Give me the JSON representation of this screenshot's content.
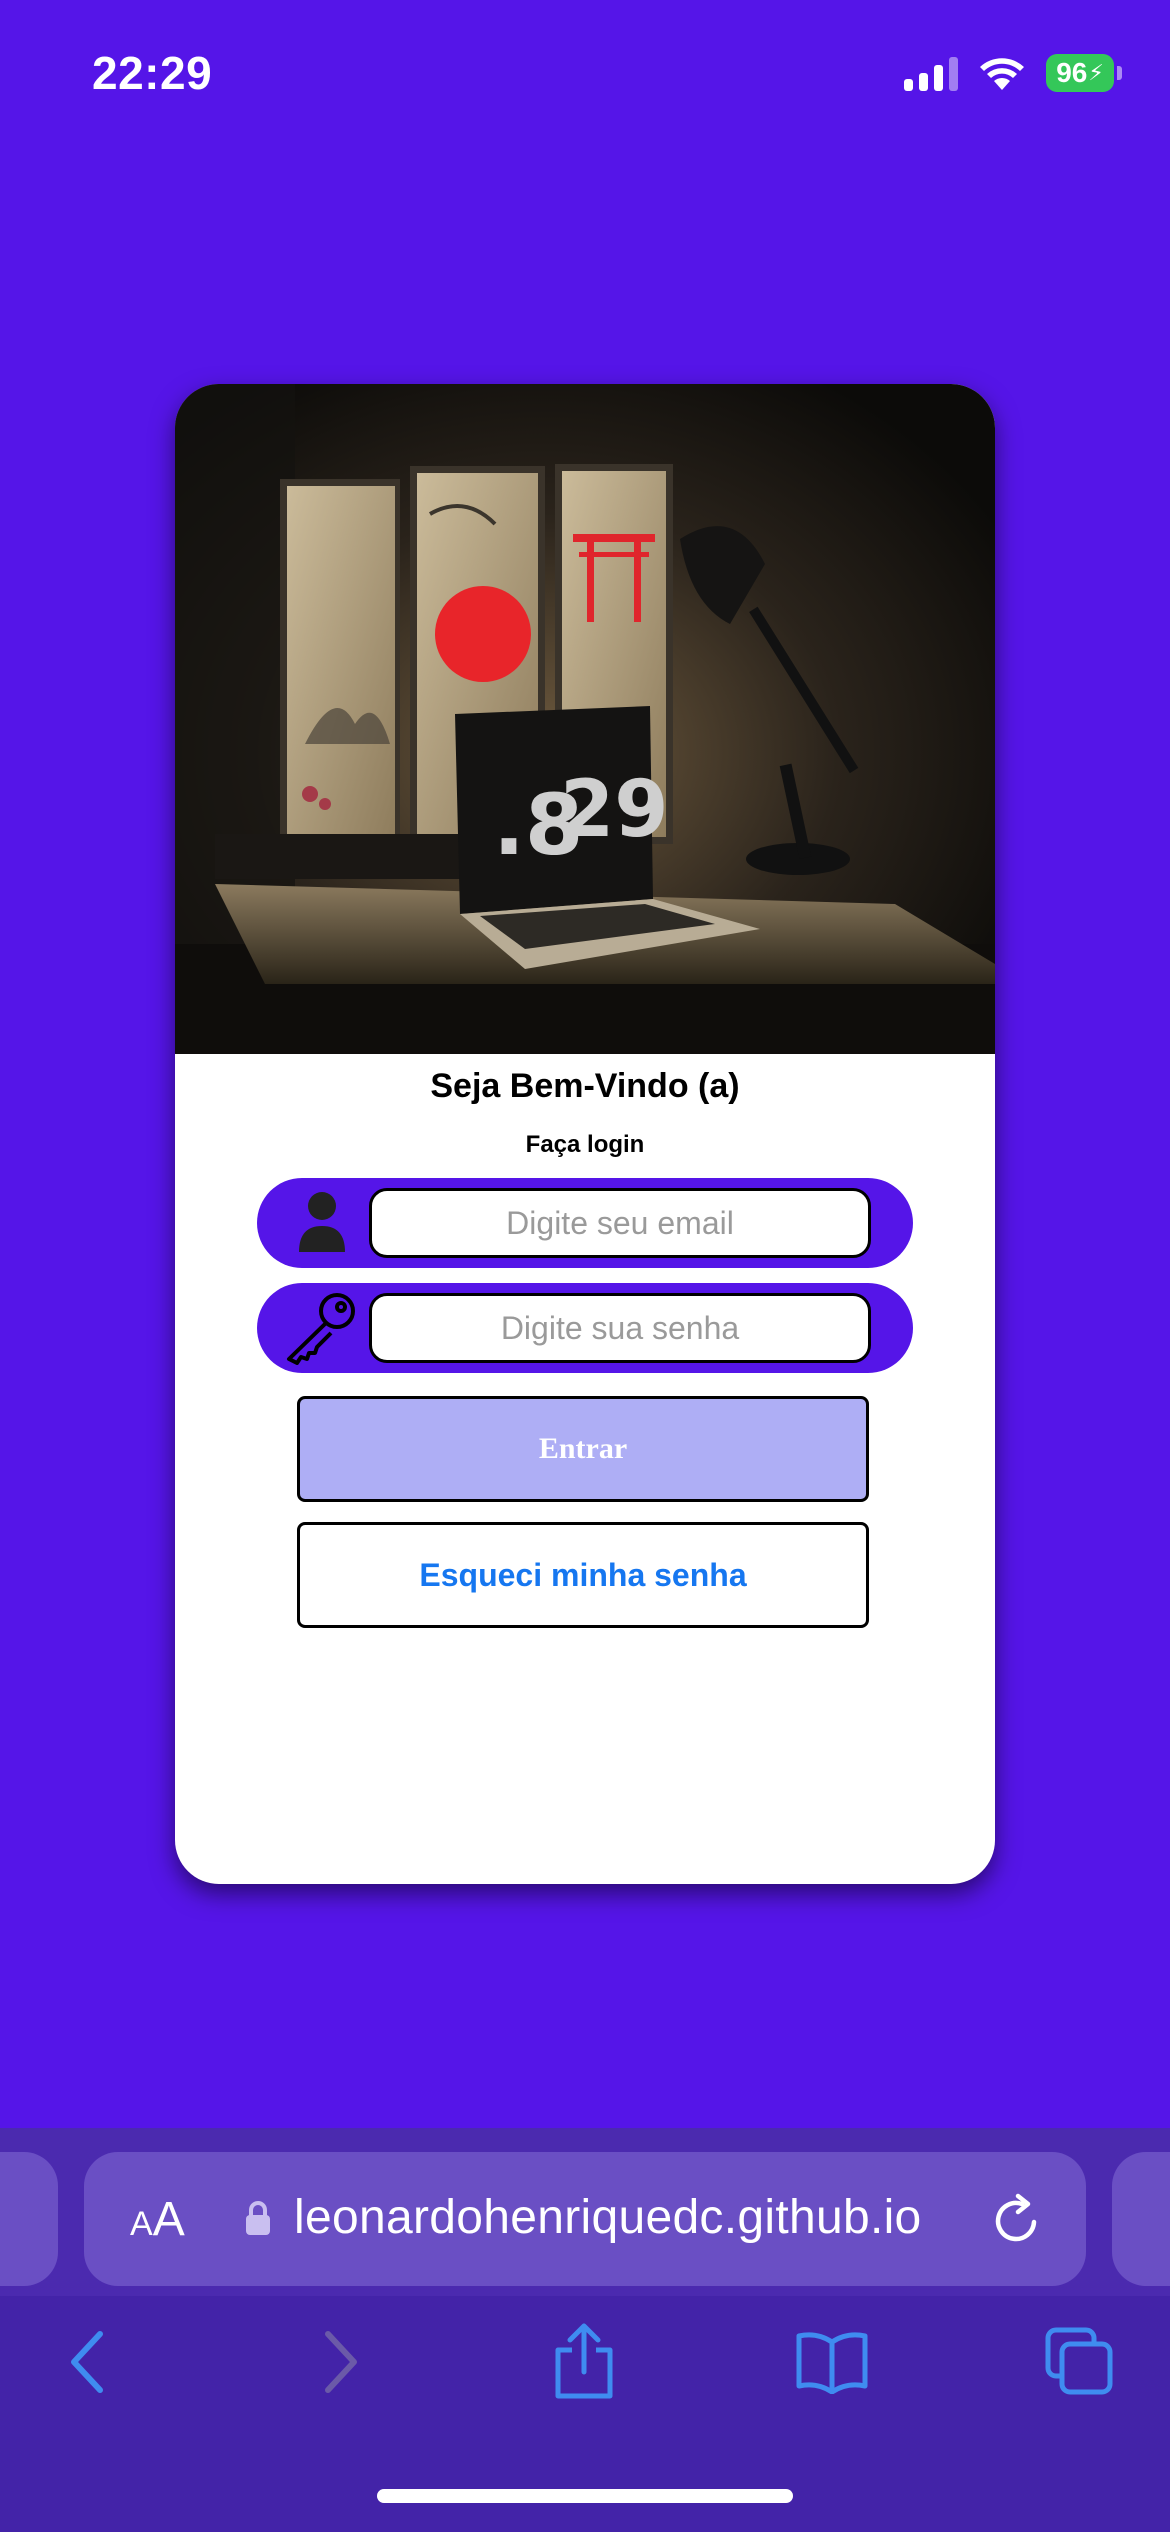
{
  "status_bar": {
    "time": "22:29",
    "battery": "96",
    "battery_color": "#34c759"
  },
  "login_card": {
    "hero_image_alt": "Desk with laptop showing 8 29 clock, desk lamp and japanese art frames",
    "hero_clock_hour": ".8",
    "hero_clock_min": "29",
    "title": "Seja Bem-Vindo (a)",
    "subtitle": "Faça login",
    "email_placeholder": "Digite seu email",
    "password_placeholder": "Digite sua senha",
    "enter_label": "Entrar",
    "forgot_label": "Esqueci minha senha"
  },
  "browser": {
    "text_size_label_small": "A",
    "text_size_label_large": "A",
    "url": "leonardohenriquedc.github.io",
    "icons": [
      "back-icon",
      "forward-icon",
      "share-icon",
      "bookmarks-icon",
      "tabs-icon"
    ]
  },
  "colors": {
    "background": "#5515e8",
    "enter_button": "#aeaef5",
    "forgot_text": "#1677f0",
    "chrome": "#4323a8"
  }
}
